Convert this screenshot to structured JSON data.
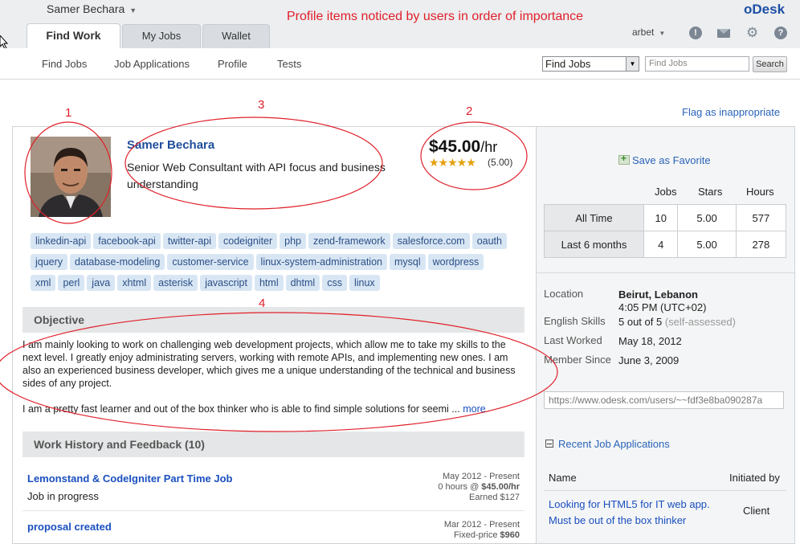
{
  "header": {
    "user_name": "Samer Bechara",
    "annotation_title": "Profile items noticed by users in order of importance",
    "logo_prefix": "o",
    "logo_text": "Desk",
    "tabs": [
      {
        "label": "Find Work"
      },
      {
        "label": "My Jobs"
      },
      {
        "label": "Wallet"
      }
    ],
    "account_label": "arbet"
  },
  "subnav": {
    "items": [
      {
        "label": "Find Jobs"
      },
      {
        "label": "Job Applications"
      },
      {
        "label": "Profile"
      },
      {
        "label": "Tests"
      }
    ],
    "search_select_value": "Find Jobs",
    "search_placeholder": "Find Jobs",
    "search_button": "Search"
  },
  "flag_link": "Flag as inappropriate",
  "profile": {
    "name": "Samer Bechara",
    "title": "Senior Web Consultant with API focus and business understanding",
    "rate_amount": "$45.00",
    "rate_unit": "/hr",
    "stars": "★★★★★",
    "rating": 5.0,
    "score": "(5.00)",
    "skills": [
      "linkedin-api",
      "facebook-api",
      "twitter-api",
      "codeigniter",
      "php",
      "zend-framework",
      "salesforce.com",
      "oauth",
      "jquery",
      "database-modeling",
      "customer-service",
      "linux-system-administration",
      "mysql",
      "wordpress",
      "xml",
      "perl",
      "java",
      "xhtml",
      "asterisk",
      "javascript",
      "html",
      "dhtml",
      "css",
      "linux"
    ]
  },
  "objective": {
    "header": "Objective",
    "text": "I am mainly looking to work on challenging web development projects, which allow me to take my skills to the next level. I greatly enjoy administrating servers, working with remote APIs, and implementing new ones. I am also an experienced business developer, which gives me a unique understanding of the technical and business sides of any project.",
    "text2": "I am a pretty fast learner and out of the box thinker who is able to find simple solutions for seemi ...",
    "more": "more"
  },
  "work_history": {
    "header": "Work History and Feedback (10)",
    "jobs": [
      {
        "title": "Lemonstand & CodeIgniter Part Time Job",
        "status": "Job in progress",
        "dates": "May 2012 - Present",
        "hours_prefix": "0 hours @ ",
        "hours_rate": "$45.00/hr",
        "earned": "Earned $127"
      },
      {
        "title": "proposal created",
        "dates": "Mar 2012 - Present",
        "price_prefix": "Fixed-price ",
        "price": "$960"
      }
    ]
  },
  "sidebar": {
    "save_favorite": "Save as Favorite",
    "stats": {
      "headers": [
        "Jobs",
        "Stars",
        "Hours"
      ],
      "rows": [
        {
          "label": "All Time",
          "jobs": "10",
          "stars": "5.00",
          "hours": "577"
        },
        {
          "label": "Last 6 months",
          "jobs": "4",
          "stars": "5.00",
          "hours": "278"
        }
      ]
    },
    "info": {
      "location_label": "Location",
      "location_value": "Beirut, Lebanon",
      "time_value": "4:05 PM (UTC+02)",
      "english_label": "English Skills",
      "english_value": "5 out of 5",
      "english_note": "(self-assessed)",
      "last_worked_label": "Last Worked",
      "last_worked_value": "May 18, 2012",
      "member_since_label": "Member Since",
      "member_since_value": "June 3, 2009"
    },
    "profile_url": "https://www.odesk.com/users/~~fdf3e8ba090287a",
    "recent_header": "Recent Job Applications",
    "recent_table": {
      "col_name": "Name",
      "col_initiated": "Initiated by",
      "rows": [
        {
          "name_line1": "Looking for HTML5 for IT web app.",
          "name_line2": "Must be out of the box thinker",
          "initiated": "Client"
        }
      ]
    }
  },
  "annotations": {
    "n1": "1",
    "n2": "2",
    "n3": "3",
    "n4": "4"
  },
  "colors": {
    "annotation": "#e0202a",
    "link": "#1a4fbf",
    "star": "#e5a00f",
    "skill_bg": "#d8e6f4"
  }
}
